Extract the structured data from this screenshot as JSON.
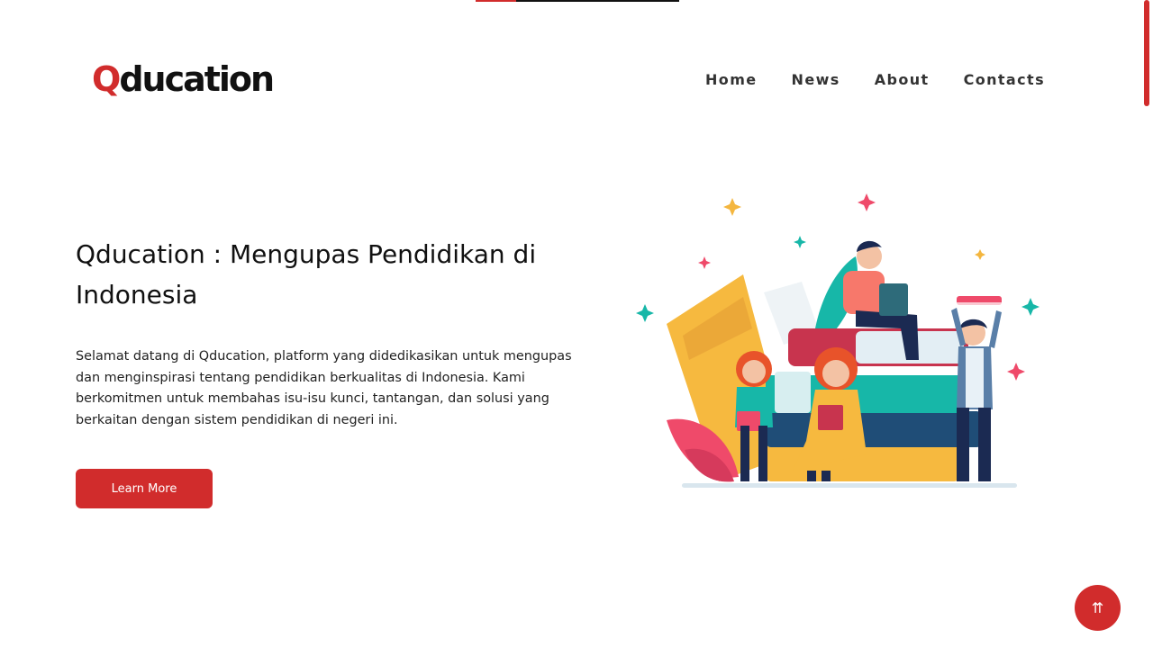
{
  "header": {
    "logo_q": "Q",
    "logo_rest": "ducation",
    "nav": [
      "Home",
      "News",
      "About",
      "Contacts"
    ]
  },
  "hero": {
    "title": "Qducation : Mengupas Pendidikan di Indonesia",
    "description": "Selamat datang di Qducation, platform yang didedikasikan untuk mengupas dan menginspirasi tentang pendidikan berkualitas di Indonesia. Kami berkomitmen untuk membahas isu-isu kunci, tantangan, dan solusi yang berkaitan dengan sistem pendidikan di negeri ini.",
    "button_label": "Learn More"
  },
  "back_to_top_icon": "⇈",
  "colors": {
    "accent": "#d12c2c",
    "text": "#111111"
  },
  "icons": {
    "back_to_top": "double-arrow-up-icon"
  },
  "scroll_progress": 0.2
}
